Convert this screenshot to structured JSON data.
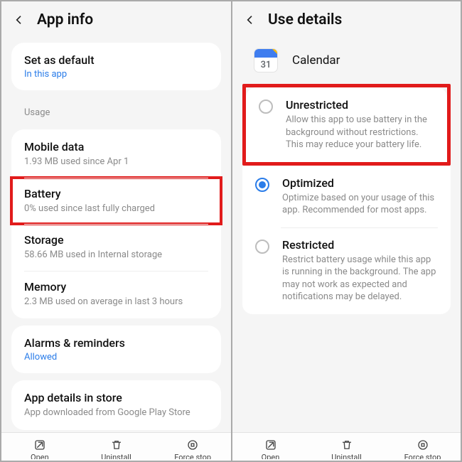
{
  "left": {
    "title": "App info",
    "set_default": {
      "label": "Set as default",
      "sub": "In this app"
    },
    "usage_header": "Usage",
    "mobile_data": {
      "label": "Mobile data",
      "sub": "1.93 MB used since Apr 1"
    },
    "battery": {
      "label": "Battery",
      "sub": "0% used since last fully charged"
    },
    "storage": {
      "label": "Storage",
      "sub": "58.66 MB used in Internal storage"
    },
    "memory": {
      "label": "Memory",
      "sub": "2.3 MB used on average in last 3 hours"
    },
    "alarms": {
      "label": "Alarms & reminders",
      "sub": "Allowed"
    },
    "store": {
      "label": "App details in store",
      "sub": "App downloaded from Google Play Store"
    },
    "bottom": {
      "open": "Open",
      "uninstall": "Uninstall",
      "force": "Force stop"
    }
  },
  "right": {
    "title": "Use details",
    "app": {
      "name": "Calendar",
      "day": "31"
    },
    "options": {
      "unrestricted": {
        "label": "Unrestricted",
        "sub": "Allow this app to use battery in the background without restrictions. This may reduce your battery life."
      },
      "optimized": {
        "label": "Optimized",
        "sub": "Optimize based on your usage of this app. Recommended for most apps."
      },
      "restricted": {
        "label": "Restricted",
        "sub": "Restrict battery usage while this app is running in the background. The app may not work as expected and notifications may be delayed."
      }
    },
    "selected": "optimized",
    "bottom": {
      "open": "Open",
      "uninstall": "Uninstall",
      "force": "Force stop"
    }
  }
}
